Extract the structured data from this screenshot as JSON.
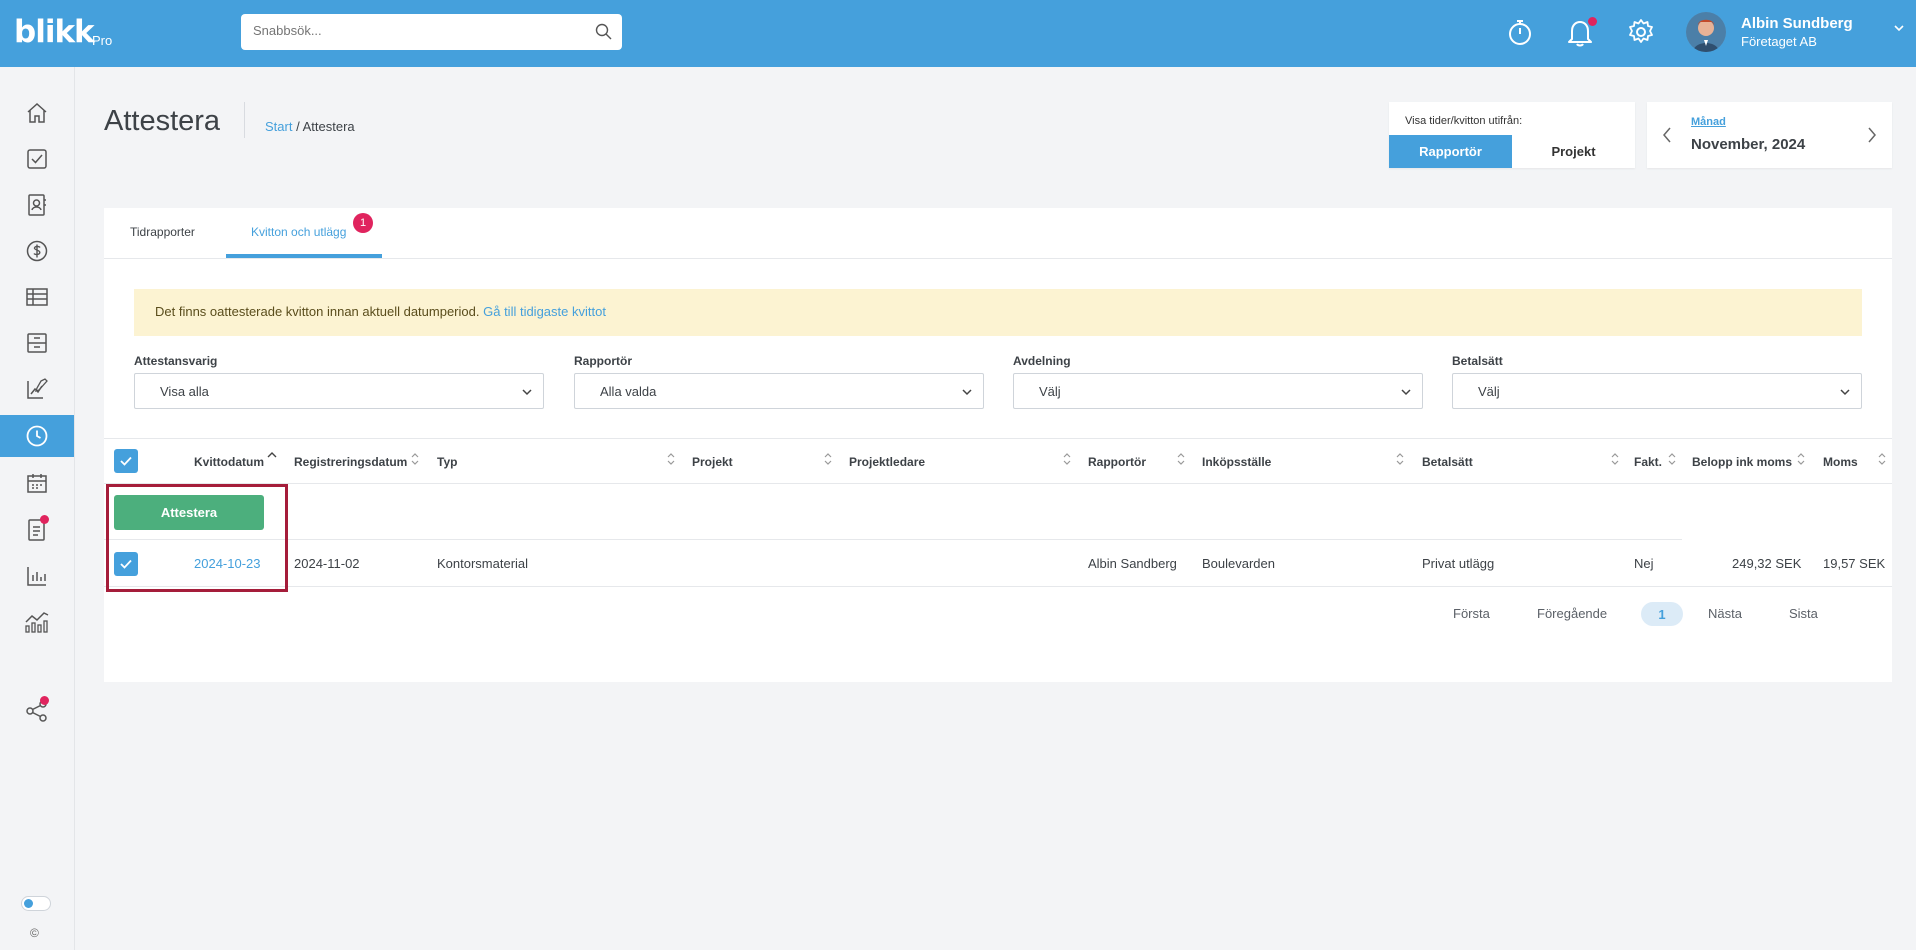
{
  "app": {
    "logo": "blikk",
    "logo_suffix": "Pro",
    "search_placeholder": "Snabbsök...",
    "user": {
      "name": "Albin Sundberg",
      "company": "Företaget AB"
    },
    "accent_color": "#45a0dc"
  },
  "sidebar": {
    "items": [
      {
        "name": "home-icon"
      },
      {
        "name": "task-check-icon"
      },
      {
        "name": "contacts-icon"
      },
      {
        "name": "dollar-icon"
      },
      {
        "name": "table-icon"
      },
      {
        "name": "archive-icon"
      },
      {
        "name": "report-edit-icon"
      },
      {
        "name": "clock-icon",
        "active": true
      },
      {
        "name": "calendar-icon"
      },
      {
        "name": "document-icon",
        "notification": true
      },
      {
        "name": "bar-chart-icon"
      },
      {
        "name": "analytics-icon"
      },
      {
        "name": "share-icon",
        "notification": true
      }
    ],
    "copyright": "©"
  },
  "header": {
    "title": "Attestera",
    "breadcrumb": {
      "start": "Start",
      "separator": "/",
      "current": "Attestera"
    }
  },
  "view_toggle": {
    "label": "Visa tider/kvitton utifrån:",
    "options": [
      "Rapportör",
      "Projekt"
    ],
    "selected": "Rapportör"
  },
  "period": {
    "type": "Månad",
    "value": "November, 2024"
  },
  "tabs": [
    {
      "label": "Tidrapporter"
    },
    {
      "label": "Kvitton och utlägg",
      "active": true,
      "badge": "1"
    }
  ],
  "alert": {
    "text": "Det finns oattesterade kvitton innan aktuell datumperiod.",
    "link": "Gå till tidigaste kvittot"
  },
  "filters": [
    {
      "label": "Attestansvarig",
      "value": "Visa alla"
    },
    {
      "label": "Rapportör",
      "value": "Alla valda"
    },
    {
      "label": "Avdelning",
      "value": "Välj"
    },
    {
      "label": "Betalsätt",
      "value": "Välj"
    }
  ],
  "table": {
    "columns": [
      "Kvittodatum",
      "Registreringsdatum",
      "Typ",
      "Projekt",
      "Projektledare",
      "Rapportör",
      "Inköpsställe",
      "Betalsätt",
      "Fakt.",
      "Belopp ink moms",
      "Moms"
    ],
    "action_button": "Attestera",
    "rows": [
      {
        "kvittodatum": "2024-10-23",
        "registreringsdatum": "2024-11-02",
        "typ": "Kontorsmaterial",
        "projekt": "",
        "projektledare": "",
        "rapportor": "Albin Sandberg",
        "inkopsstalle": "Boulevarden",
        "betalsatt": "Privat utlägg",
        "fakt": "Nej",
        "belopp": "249,32 SEK",
        "moms": "19,57 SEK",
        "checked": true
      }
    ]
  },
  "pagination": {
    "first": "Första",
    "previous": "Föregående",
    "current": "1",
    "next": "Nästa",
    "last": "Sista"
  }
}
